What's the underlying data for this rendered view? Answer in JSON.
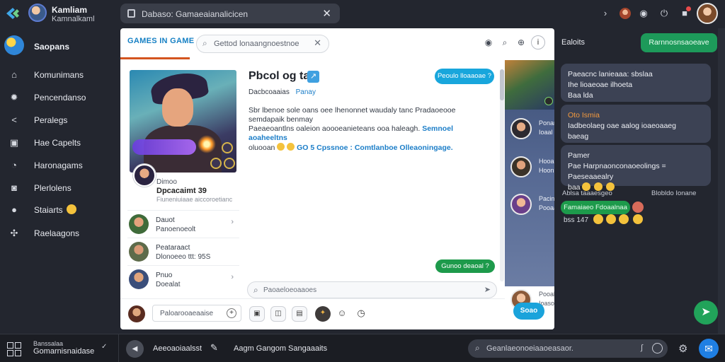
{
  "topbar": {
    "brand_name": "Kamliam",
    "brand_sub": "Kamnalkaml",
    "search_text": "Dabaso: Gamaeaianalicicen",
    "close_glyph": "✕"
  },
  "leftnav": {
    "head_label": "Saopans",
    "items": [
      {
        "label": "Komunimans",
        "icon": "home-icon"
      },
      {
        "label": "Pencendanso",
        "icon": "gear-icon"
      },
      {
        "label": "Peralegs",
        "icon": "share-icon"
      },
      {
        "label": "Hae Capelts",
        "icon": "image-icon"
      },
      {
        "label": "Haronagams",
        "icon": "bell-icon"
      },
      {
        "label": "Plerlolens",
        "icon": "gamepad-icon"
      },
      {
        "label": "Staiarts",
        "icon": "globe-icon"
      },
      {
        "label": "Raelaagons",
        "icon": "network-icon"
      }
    ]
  },
  "main": {
    "tab_label": "GAMES IN GAME",
    "search_text": "Gettod lonaangnoestnoe",
    "info_glyph": "i",
    "profile": {
      "name_small": "Dimoo",
      "name_bold": "Dpcacaimt 39",
      "handle": "Fiuneniuiaae aiccoroetianc"
    },
    "list": [
      {
        "t1": "Dauot",
        "t2": "Panoenoeolt",
        "chevron": "›",
        "color": "#4b6b3a"
      },
      {
        "t1": "Peataraact",
        "t2": "Dlonoeeo ttt: 95S",
        "chevron": "›",
        "color": "#5d6b4a"
      },
      {
        "t1": "Pnuo",
        "t2": "Doealat",
        "chevron": "›",
        "color": "#3a4e7a"
      }
    ],
    "post": {
      "title": "Pbcol og takl",
      "title_icon": "↗",
      "meta": "Dacbcoaaias",
      "meta_link": "Panay",
      "body_line1": "Sbr lbenoe sole oans oee lhenonnet waudaly tanc Pradaoeooe semdapaik benmay",
      "body_line2": "Paeaeoantlns oaleion aoooeanieteans ooa haleagh.",
      "body_tag1": "Semnoel aoaheeltns",
      "body_line3": "oluooan",
      "body_tag2": "GO 5 Cpssnoe : Comtlanboe Olleaoningage."
    },
    "bubble_top": "Peoulo lloaaoae ?",
    "bubble_green": "Gunoo deaoal ?",
    "composer_text": "Paoaeloeoaaoes",
    "composer_send": "➤",
    "bottom_input": "Paloarooaeaaise",
    "bottom_plus": "+",
    "strip": [
      {
        "t1": "Ponan",
        "t2": "Ioaal"
      },
      {
        "t1": "Hooa",
        "t2": "Hoon"
      },
      {
        "t1": "Pacin",
        "t2": "Pooaa"
      },
      {
        "t1": "Pooaln",
        "t2": "Ioaso"
      }
    ],
    "send_label": "Soao"
  },
  "rightpanel": {
    "title": "Ealoits",
    "button_label": "Rarnnosnsaoeave",
    "cards": [
      {
        "l1": "Paeacnc lanieaaa: sbslaa",
        "l2": "Ihe lioaeoae ilhoeta",
        "l3": "Baa lda"
      },
      {
        "hl": "Oto Ismia",
        "l1": "Iadbeolaeg oae aalog ioaeoaaeg",
        "l2": "baeag"
      },
      {
        "l1": "Pamer",
        "l2": "Pae Harpnaonconaoeolings = Paeseaaealry",
        "l3": "baa"
      }
    ],
    "meta_left": "Ablsa taaaesgeo",
    "meta_right": "Blobldo Ionane",
    "reply_label": "Famaiaeo Fdoaalnaa",
    "count": "bss 147",
    "fab_glyph": "➤"
  },
  "taskbar": {
    "name": "Banssalaa",
    "sub": "Gomarnisnaidase",
    "chevron": "✓",
    "play_glyph": "◀",
    "t1": "Aeeoaoiaalsst",
    "t2": "Aagm Gangom Sangaaaits",
    "search_text": "Geanlaeonoeiaaoeasaor.",
    "mic_glyph": "⌕",
    "gear_glyph": "⚙",
    "msg_glyph": "✉"
  },
  "colors": {
    "accent_blue": "#18a6dc",
    "accent_green": "#1d9a4b",
    "tab_underline": "#d4551f",
    "notification": "#e84a4a"
  }
}
